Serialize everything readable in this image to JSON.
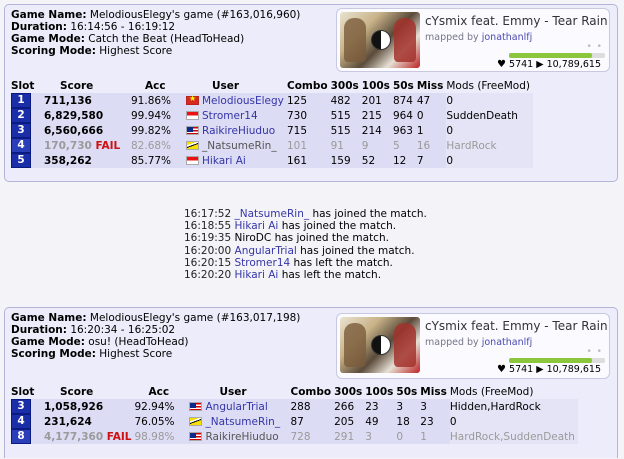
{
  "match1": {
    "labels": {
      "game_name": "Game Name:",
      "duration": "Duration:",
      "game_mode": "Game Mode:",
      "scoring_mode": "Scoring Mode:"
    },
    "game_name": "MelodiousElegy's game (#163,016,960)",
    "duration": "16:14:56 - 16:19:12",
    "game_mode": "Catch the Beat (HeadToHead)",
    "scoring_mode": "Highest Score",
    "beatmap": {
      "title": "cYsmix feat. Emmy - Tear Rain",
      "mapped_by": "mapped by",
      "mapper": "jonathanlfj",
      "dots": "• •",
      "favorites": "5741",
      "plays": "10,789,615",
      "rating_fraction": 0.86
    },
    "headers": {
      "slot": "Slot",
      "score": "Score",
      "acc": "Acc",
      "user": "User",
      "combo": "Combo",
      "c300": "300s",
      "c100": "100s",
      "c50": "50s",
      "miss": "Miss",
      "mods": "Mods (FreeMod)"
    },
    "rows": [
      {
        "slot": "1",
        "score": "711,136",
        "fail": "",
        "acc": "91.86%",
        "flag": "vn",
        "user": "MelodiousElegy",
        "combo": "125",
        "c300": "482",
        "c100": "201",
        "c50": "874",
        "miss": "47",
        "mods": "0"
      },
      {
        "slot": "2",
        "score": "6,829,580",
        "fail": "",
        "acc": "99.94%",
        "flag": "sg",
        "user": "Stromer14",
        "combo": "730",
        "c300": "515",
        "c100": "215",
        "c50": "964",
        "miss": "0",
        "mods": "SuddenDeath"
      },
      {
        "slot": "3",
        "score": "6,560,666",
        "fail": "",
        "acc": "99.82%",
        "flag": "my",
        "user": "RaikireHiuduo",
        "combo": "715",
        "c300": "515",
        "c100": "214",
        "c50": "963",
        "miss": "1",
        "mods": "0"
      },
      {
        "slot": "4",
        "score": "170,730",
        "fail": "FAIL",
        "acc": "82.68%",
        "flag": "bn",
        "user": "_NatsumeRin_",
        "combo": "101",
        "c300": "91",
        "c100": "9",
        "c50": "5",
        "miss": "16",
        "mods": "HardRock"
      },
      {
        "slot": "5",
        "score": "358,262",
        "fail": "",
        "acc": "85.77%",
        "flag": "id",
        "user": "Hikari Ai",
        "combo": "161",
        "c300": "159",
        "c100": "52",
        "c50": "12",
        "miss": "7",
        "mods": "0"
      }
    ]
  },
  "events": [
    {
      "time": "16:17:52",
      "user": "_NatsumeRin_",
      "text": "has joined the match.",
      "linked": true
    },
    {
      "time": "16:18:55",
      "user": "Hikari Ai",
      "text": "has joined the match.",
      "linked": true
    },
    {
      "time": "16:19:35",
      "user": "NiroDC",
      "text": "has joined the match.",
      "linked": false
    },
    {
      "time": "16:20:00",
      "user": "AngularTrial",
      "text": "has joined the match.",
      "linked": true
    },
    {
      "time": "16:20:15",
      "user": "Stromer14",
      "text": "has left the match.",
      "linked": true
    },
    {
      "time": "16:20:20",
      "user": "Hikari Ai",
      "text": "has left the match.",
      "linked": true
    }
  ],
  "match2": {
    "labels": {
      "game_name": "Game Name:",
      "duration": "Duration:",
      "game_mode": "Game Mode:",
      "scoring_mode": "Scoring Mode:"
    },
    "game_name": "MelodiousElegy's game (#163,017,198)",
    "duration": "16:20:34 - 16:25:02",
    "game_mode": "osu! (HeadToHead)",
    "scoring_mode": "Highest Score",
    "beatmap": {
      "title": "cYsmix feat. Emmy - Tear Rain",
      "mapped_by": "mapped by",
      "mapper": "jonathanlfj",
      "dots": "• •",
      "favorites": "5741",
      "plays": "10,789,615",
      "rating_fraction": 0.86
    },
    "headers": {
      "slot": "Slot",
      "score": "Score",
      "acc": "Acc",
      "user": "User",
      "combo": "Combo",
      "c300": "300s",
      "c100": "100s",
      "c50": "50s",
      "miss": "Miss",
      "mods": "Mods (FreeMod)"
    },
    "rows": [
      {
        "slot": "3",
        "score": "1,058,926",
        "fail": "",
        "acc": "92.94%",
        "flag": "my",
        "user": "AngularTrial",
        "combo": "288",
        "c300": "266",
        "c100": "23",
        "c50": "3",
        "miss": "3",
        "mods": "Hidden,HardRock"
      },
      {
        "slot": "4",
        "score": "231,624",
        "fail": "",
        "acc": "76.05%",
        "flag": "bn",
        "user": "_NatsumeRin_",
        "combo": "87",
        "c300": "205",
        "c100": "49",
        "c50": "18",
        "miss": "23",
        "mods": "0"
      },
      {
        "slot": "8",
        "score": "4,177,360",
        "fail": "FAIL",
        "acc": "98.98%",
        "flag": "my",
        "user": "RaikireHiuduo",
        "combo": "728",
        "c300": "291",
        "c100": "3",
        "c50": "0",
        "miss": "1",
        "mods": "HardRock,SuddenDeath"
      }
    ]
  }
}
